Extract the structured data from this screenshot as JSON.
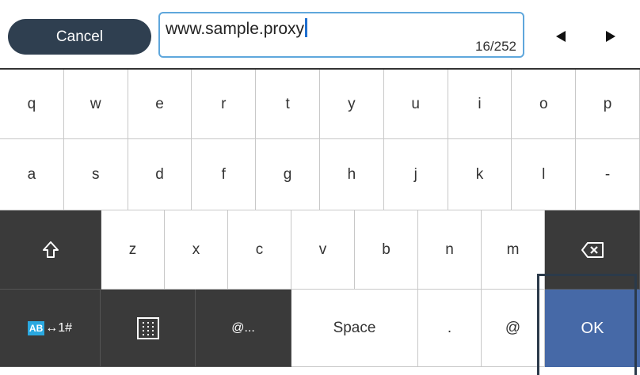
{
  "header": {
    "cancel_label": "Cancel",
    "input_value": "www.sample.proxy",
    "char_counter": "16/252"
  },
  "keyboard": {
    "row1": [
      "q",
      "w",
      "e",
      "r",
      "t",
      "y",
      "u",
      "i",
      "o",
      "p"
    ],
    "row2": [
      "a",
      "s",
      "d",
      "f",
      "g",
      "h",
      "j",
      "k",
      "l",
      "-"
    ],
    "row3": [
      "z",
      "x",
      "c",
      "v",
      "b",
      "n",
      "m"
    ],
    "row4": {
      "mode_label": "↔1#",
      "mode_icon_text": "AB",
      "at_domain_label": "@...",
      "space_label": "Space",
      "dot_label": ".",
      "at_label": "@",
      "ok_label": "OK"
    }
  },
  "colors": {
    "cancel_bg": "#2f3f50",
    "input_border": "#5fa7dc",
    "dark_key": "#3a3a3a",
    "ok_key": "#4669a7",
    "mode_icon_bg": "#2aa8e0"
  }
}
